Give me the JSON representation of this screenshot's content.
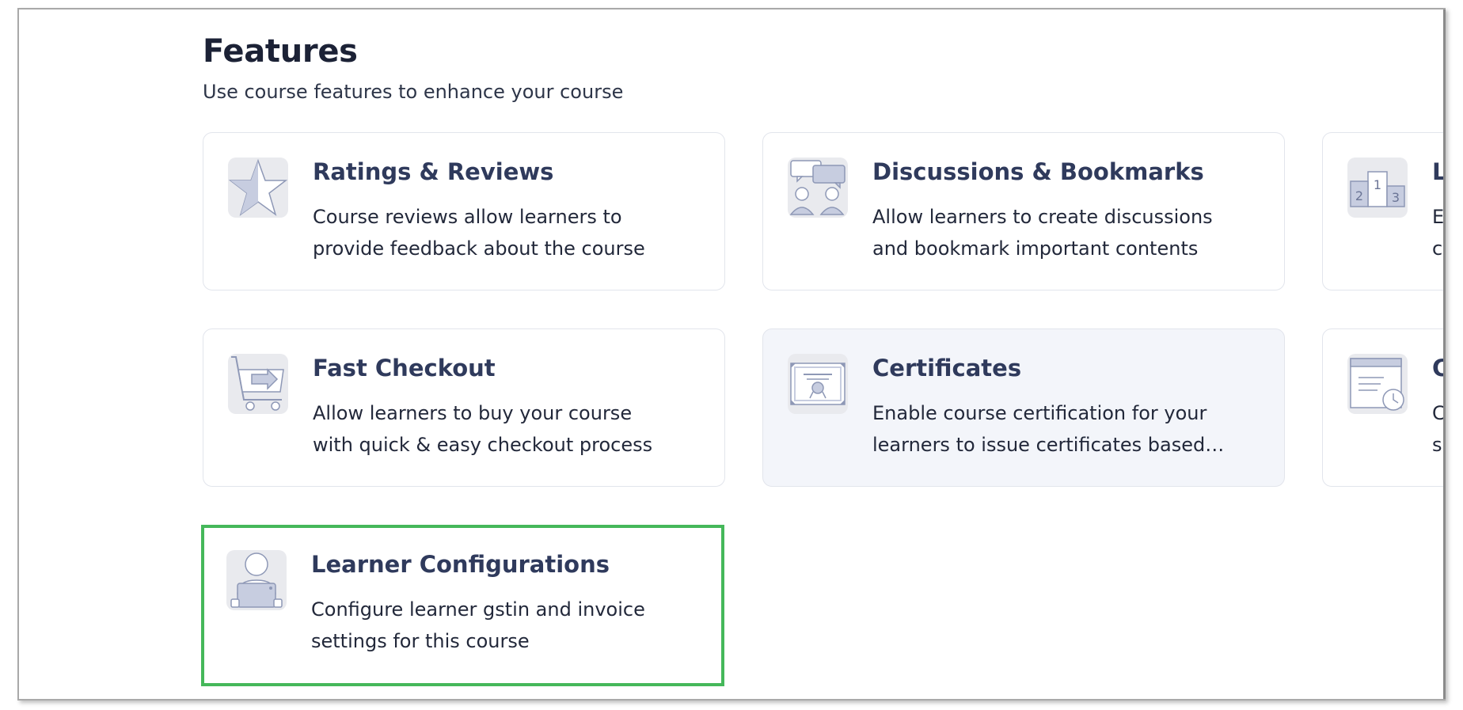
{
  "header": {
    "title": "Features",
    "subtitle": "Use course features to enhance your course"
  },
  "features": [
    {
      "title": "Ratings & Reviews",
      "desc_line1": "Course reviews allow learners to",
      "desc_line2": "provide feedback about the course",
      "icon": "star-icon"
    },
    {
      "title": "Discussions & Bookmarks",
      "desc_line1": "Allow learners to create discussions",
      "desc_line2": "and bookmark important contents",
      "icon": "discussion-icon"
    },
    {
      "title": "L",
      "desc_line1": "E",
      "desc_line2": "c",
      "icon": "podium-icon"
    },
    {
      "title": "Fast Checkout",
      "desc_line1": "Allow learners to buy your course",
      "desc_line2": "with quick & easy checkout process",
      "icon": "cart-icon"
    },
    {
      "title": "Certificates",
      "desc_line1": "Enable course certification for your",
      "desc_line2": "learners to issue certificates based…",
      "icon": "certificate-icon"
    },
    {
      "title": "C",
      "desc_line1": "C",
      "desc_line2": "s",
      "icon": "schedule-icon"
    },
    {
      "title": "Learner Configurations",
      "desc_line1": "Configure learner gstin and invoice",
      "desc_line2": "settings for this course",
      "icon": "learner-icon"
    }
  ],
  "colors": {
    "selected_border": "#45b85a",
    "icon_tint": "#c7cde0",
    "icon_stroke": "#8e98b6",
    "hover_bg": "#f3f5fa"
  }
}
